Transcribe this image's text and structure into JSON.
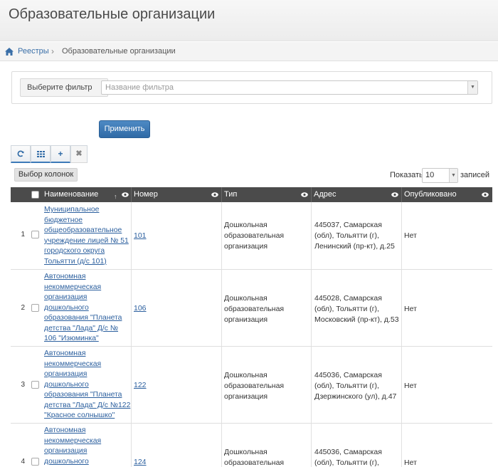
{
  "header": {
    "title": "Образовательные организации"
  },
  "breadcrumb": {
    "home": "Реестры",
    "current": "Образовательные организации"
  },
  "filter": {
    "label": "Выберите фильтр",
    "placeholder": "Название фильтра"
  },
  "apply_label": "Применить",
  "toolbar": {
    "icons": [
      "refresh-icon",
      "grid-icon",
      "plus-icon",
      "close-icon"
    ]
  },
  "columns_button": "Выбор колонок",
  "paging": {
    "show_label": "Показать",
    "value": "10",
    "records_label": "записей"
  },
  "table": {
    "headers": [
      "Наименование",
      "Номер",
      "Тип",
      "Адрес",
      "Опубликовано"
    ],
    "rows": [
      {
        "n": "1",
        "name": [
          "Муниципальное",
          "бюджетное",
          "общеобразовательное",
          "учреждение лицей № 51",
          "городского округа",
          "Тольятти (д/с 101)"
        ],
        "number": "101",
        "type": [
          "Дошкольная",
          "образовательная",
          "организация"
        ],
        "address": [
          "445037, Самарская",
          "(обл), Тольятти (г),",
          "Ленинский (пр-кт), д.25"
        ],
        "published": "Нет"
      },
      {
        "n": "2",
        "name": [
          "Автономная",
          "некоммерческая",
          "организация",
          "дошкольного",
          "образования \"Планета",
          "детства \"Лада\" Д/с №",
          "106 \"Изюминка\""
        ],
        "number": "106",
        "type": [
          "Дошкольная",
          "образовательная",
          "организация"
        ],
        "address": [
          "445028, Самарская",
          "(обл), Тольятти (г),",
          "Московский (пр-кт), д.53"
        ],
        "published": "Нет"
      },
      {
        "n": "3",
        "name": [
          "Автономная",
          "некоммерческая",
          "организация",
          "дошкольного",
          "образования \"Планета",
          "детства \"Лада\" Д/с №122",
          "\"Красное солнышко\""
        ],
        "number": "122",
        "type": [
          "Дошкольная",
          "образовательная",
          "организация"
        ],
        "address": [
          "445036, Самарская",
          "(обл), Тольятти (г),",
          "Дзержинского (ул), д.47"
        ],
        "published": "Нет"
      },
      {
        "n": "4",
        "name": [
          "Автономная",
          "некоммерческая",
          "организация",
          "дошкольного"
        ],
        "number": "124",
        "type": [
          "Дошкольная",
          "образовательная"
        ],
        "address": [
          "445036, Самарская",
          "(обл), Тольятти (г),"
        ],
        "published": "Нет"
      }
    ]
  }
}
